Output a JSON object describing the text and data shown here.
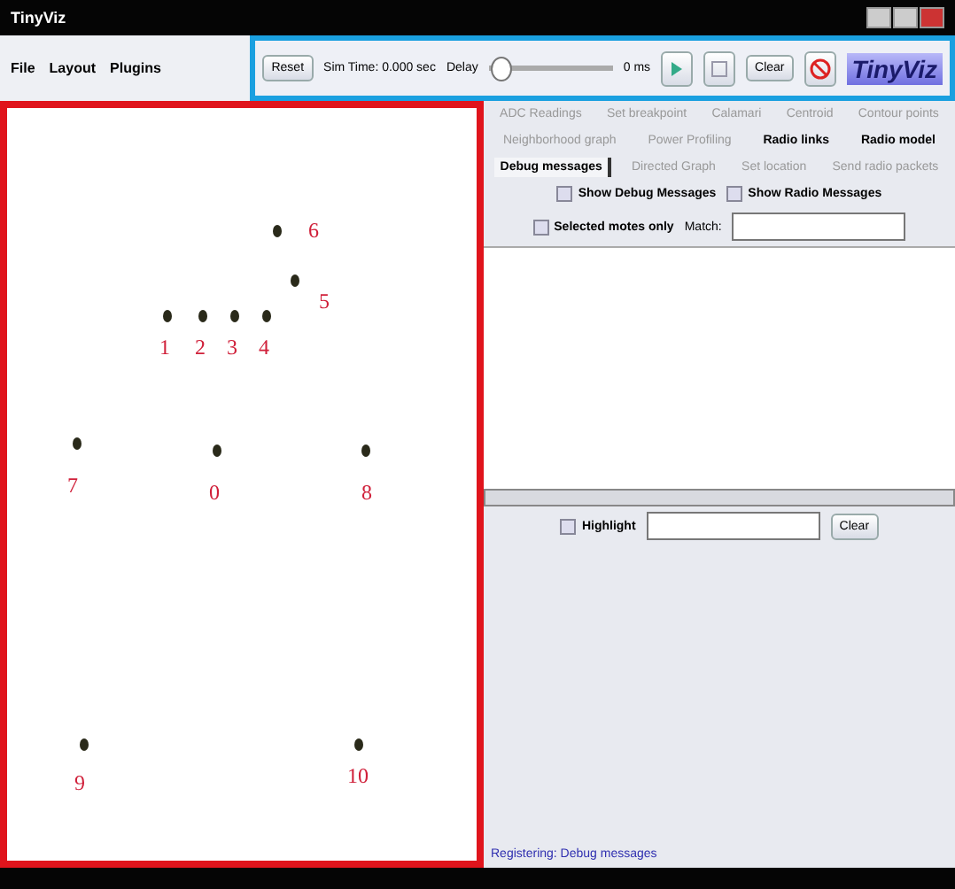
{
  "window": {
    "title": "TinyViz"
  },
  "menu": [
    "File",
    "Layout",
    "Plugins"
  ],
  "toolbar": {
    "reset": "Reset",
    "sim_time": "Sim Time: 0.000 sec",
    "delay_label": "Delay",
    "delay": {
      "level": 0
    },
    "delay_reading": "0 ms",
    "clear": "Clear",
    "logo": "TinyViz"
  },
  "motes": [
    {
      "label": "6"
    },
    {
      "label": "5"
    },
    {
      "label": "1"
    },
    {
      "label": "2"
    },
    {
      "label": "3"
    },
    {
      "label": "4"
    },
    {
      "label": "7"
    },
    {
      "label": "0"
    },
    {
      "label": "8"
    },
    {
      "label": "9"
    },
    {
      "label": "10"
    }
  ],
  "tab_rows": [
    [
      {
        "label": "ADC Readings",
        "enabled": false,
        "selected": false
      },
      {
        "label": "Set breakpoint",
        "enabled": false,
        "selected": false
      },
      {
        "label": "Calamari",
        "enabled": false,
        "selected": false
      },
      {
        "label": "Centroid",
        "enabled": false,
        "selected": false
      },
      {
        "label": "Contour points",
        "enabled": false,
        "selected": false
      }
    ],
    [
      {
        "label": "Neighborhood graph",
        "enabled": false,
        "selected": false
      },
      {
        "label": "Power Profiling",
        "enabled": false,
        "selected": false
      },
      {
        "label": "Radio links",
        "enabled": true,
        "selected": false
      },
      {
        "label": "Radio model",
        "enabled": true,
        "selected": false
      }
    ],
    [
      {
        "label": "Debug messages",
        "enabled": true,
        "selected": true
      },
      {
        "label": "Directed Graph",
        "enabled": false,
        "selected": false
      },
      {
        "label": "Set location",
        "enabled": false,
        "selected": false
      },
      {
        "label": "Send radio packets",
        "enabled": false,
        "selected": false
      }
    ]
  ],
  "options": [
    {
      "label": "Show Debug Messages",
      "checked": false
    },
    {
      "label": "Show Radio Messages",
      "checked": false
    }
  ],
  "filter": {
    "label": "Selected motes only",
    "checked": false,
    "match_label": "Match:"
  },
  "highlight": {
    "label": "Highlight",
    "checked": false,
    "clear": "Clear"
  },
  "status": "Registering: Debug messages"
}
